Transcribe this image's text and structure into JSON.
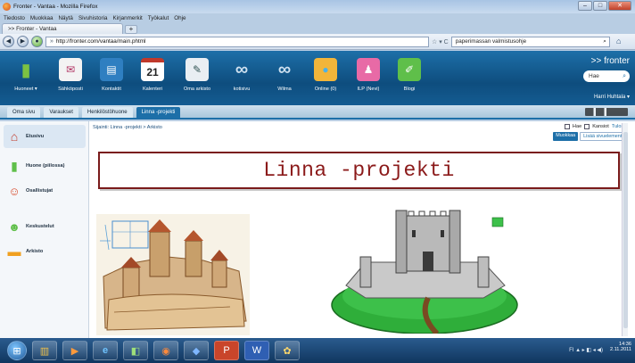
{
  "window": {
    "title": "Fronter - Vantaa - Mozilla Firefox",
    "controls": [
      "–",
      "□",
      "✕"
    ]
  },
  "menu": [
    "Tiedosto",
    "Muokkaa",
    "Näytä",
    "Sivuhistoria",
    "Kirjanmerkit",
    "Työkalut",
    "Ohje"
  ],
  "browser_tab": {
    "label": ">> Fronter - Vantaa",
    "new_tab": "+"
  },
  "nav": {
    "url": "http://fronter.com/vantaa/main.phtml",
    "search_value": "paperimassan valmistusohje"
  },
  "fronter": {
    "brand": ">> fronter",
    "search_placeholder": "Hae",
    "user": "Harri Huhtala ▾",
    "tools": [
      {
        "label": "Huoneet ▾",
        "icon": "door-icon",
        "glyph": "▮",
        "color": "#7cc242"
      },
      {
        "label": "Sähköposti",
        "icon": "mail-icon",
        "glyph": "✉",
        "color": "#f3f3f3"
      },
      {
        "label": "Kontaktit",
        "icon": "contacts-icon",
        "glyph": "▤",
        "color": "#2f7fc1"
      },
      {
        "label": "Kalenteri",
        "icon": "calendar-icon",
        "glyph": "21",
        "color": "#ffffff"
      },
      {
        "label": "Oma arkisto",
        "icon": "archive-icon",
        "glyph": "✎",
        "color": "#e9eef3"
      },
      {
        "label": "kotisivu",
        "icon": "link-icon",
        "glyph": "∞",
        "color": "#1d6fa8"
      },
      {
        "label": "Wilma",
        "icon": "link-icon",
        "glyph": "∞",
        "color": "#1d6fa8"
      },
      {
        "label": "Online (0)",
        "icon": "online-icon",
        "glyph": "●",
        "color": "#4bb1e8"
      },
      {
        "label": "ILP (Nevi)",
        "icon": "ilp-icon",
        "glyph": "♟",
        "color": "#e86aa6"
      },
      {
        "label": "Blogi",
        "icon": "blog-icon",
        "glyph": "✐",
        "color": "#5fbf4a"
      }
    ]
  },
  "room_tabs": [
    "Oma sivu",
    "Varaukset",
    "Henkilöstöhuone",
    "Linna -projekti"
  ],
  "sidebar": [
    {
      "label": "Etusivu",
      "icon": "home-icon",
      "glyph": "⌂",
      "color": "#c23b2a"
    },
    {
      "label": "Huone (piilossa)",
      "icon": "door-icon",
      "glyph": "▮",
      "color": "#5fbf4a"
    },
    {
      "label": "Osallistujat",
      "icon": "participants-icon",
      "glyph": "☺",
      "color": "#d84a2a"
    },
    {
      "label": "Keskustelut",
      "icon": "discussion-icon",
      "glyph": "☻",
      "color": "#5fbf4a"
    },
    {
      "label": "Arkisto",
      "icon": "folder-icon",
      "glyph": "▬",
      "color": "#f0a020"
    }
  ],
  "main": {
    "breadcrumb": "Sijainti: Linna -projekti > Arkisto",
    "options": {
      "hae": "Hae",
      "kansiot": "Kansiot",
      "tulosta": "Tulosta"
    },
    "actions": {
      "muokkaa": "Muokkaa",
      "lisaa": "Lisää sivuelementti"
    },
    "heading": "Linna -projekti"
  },
  "taskbar": {
    "apps": [
      {
        "icon": "windows-start-icon",
        "glyph": "⊞"
      },
      {
        "icon": "explorer-icon",
        "glyph": "▥"
      },
      {
        "icon": "media-icon",
        "glyph": "▶"
      },
      {
        "icon": "ie-icon",
        "glyph": "e"
      },
      {
        "icon": "files-icon",
        "glyph": "◧"
      },
      {
        "icon": "firefox-icon",
        "glyph": "◉"
      },
      {
        "icon": "app-icon",
        "glyph": "◆"
      },
      {
        "icon": "powerpoint-icon",
        "glyph": "P"
      },
      {
        "icon": "word-icon",
        "glyph": "W"
      },
      {
        "icon": "paint-icon",
        "glyph": "✿"
      }
    ],
    "tray_icons": "FI ▲ ▸ ◧ ◂ ◀)",
    "time": "14:36",
    "date": "2.11.2011"
  }
}
